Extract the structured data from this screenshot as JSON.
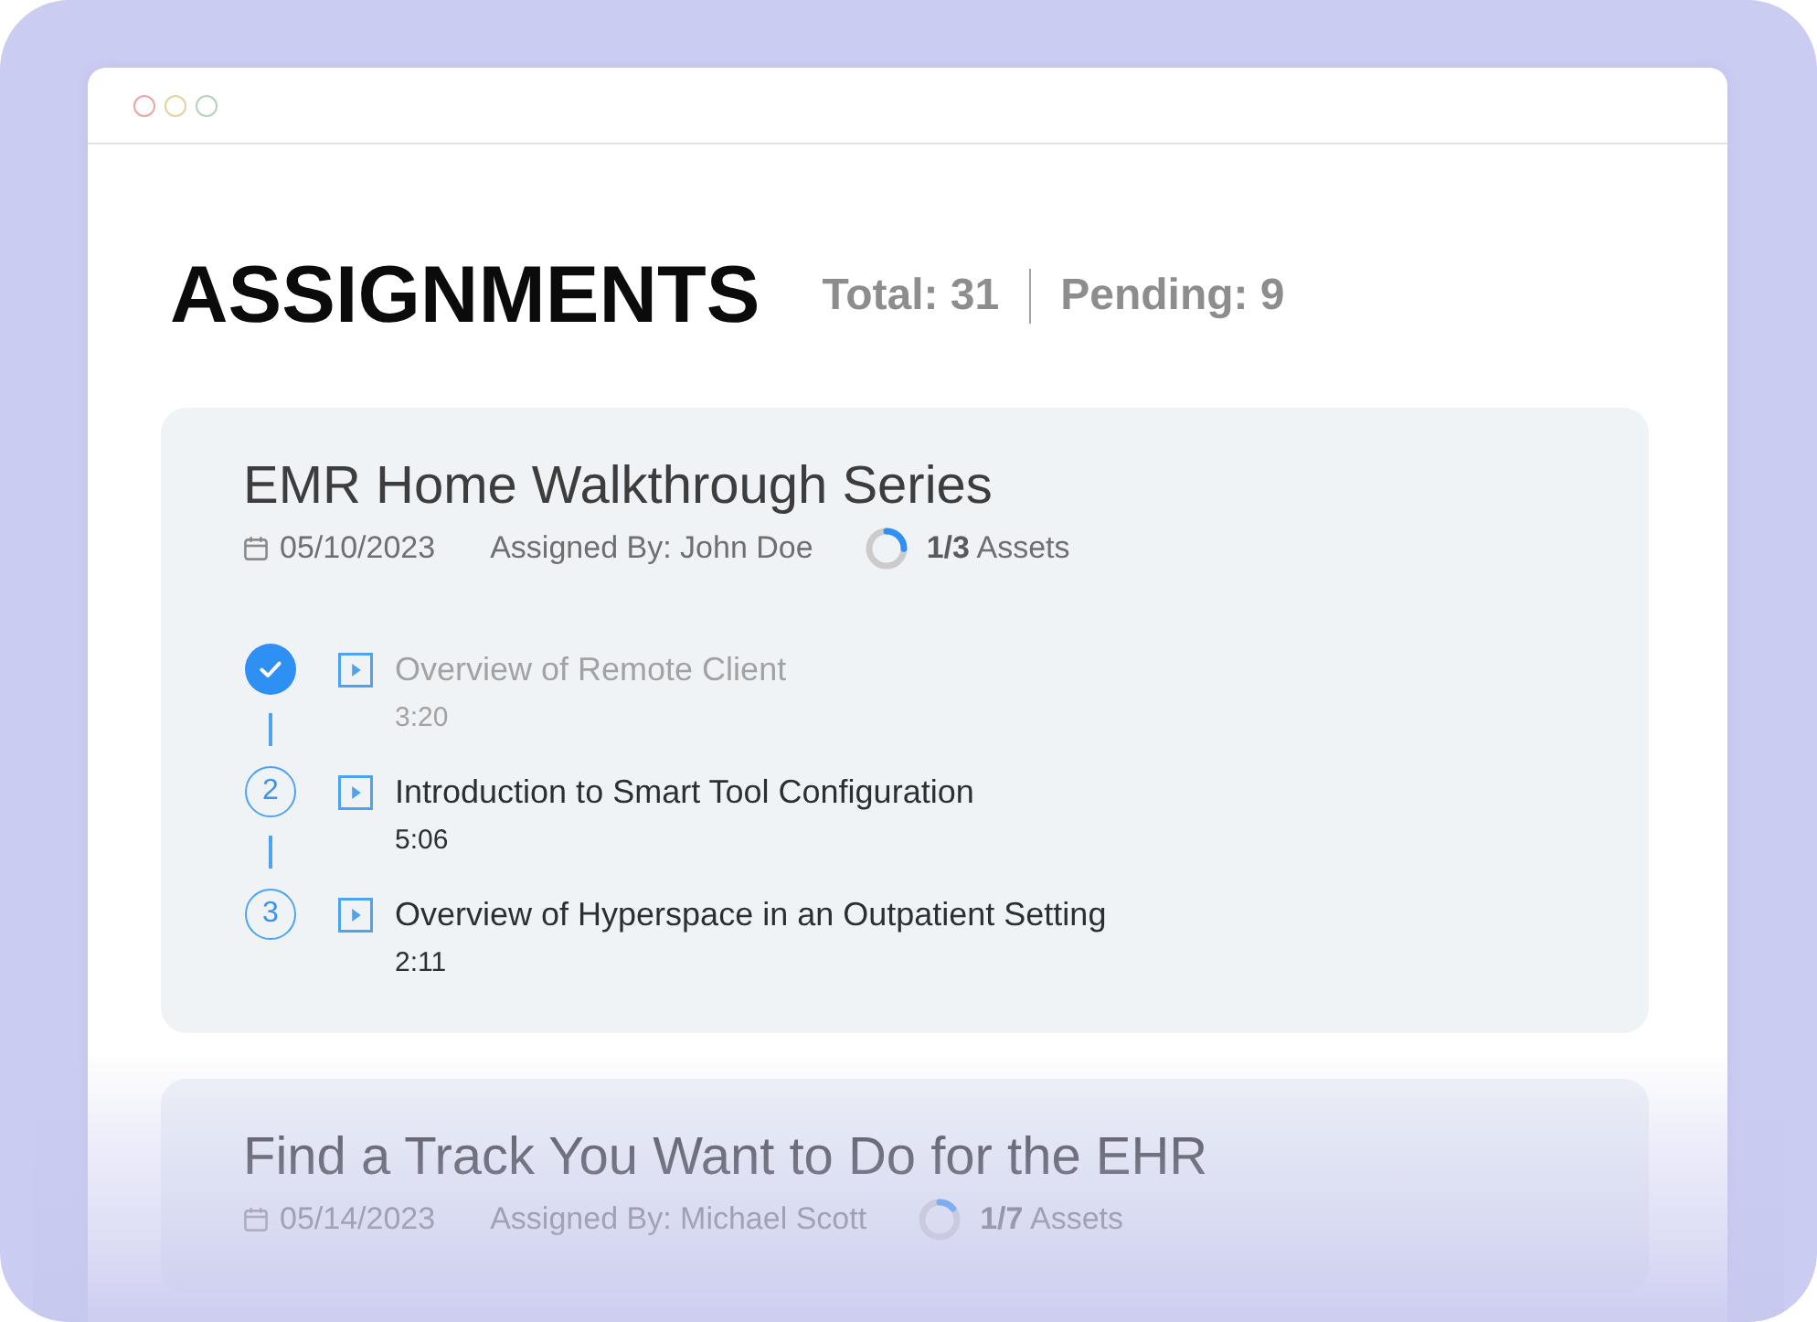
{
  "header": {
    "title": "ASSIGNMENTS",
    "total": "Total: 31",
    "pending": "Pending: 9"
  },
  "assignments": [
    {
      "title": "EMR Home Walkthrough Series",
      "date": "05/10/2023",
      "assigned_by": "Assigned By: John Doe",
      "progress": {
        "level": 0.25,
        "label": "**1/3** Assets"
      },
      "lessons": [
        {
          "completed": true,
          "title": "Overview of Remote Client",
          "duration": "3:20"
        },
        {
          "completed": false,
          "number": "2",
          "title": "Introduction to Smart Tool Configuration",
          "duration": "5:06"
        },
        {
          "completed": false,
          "number": "3",
          "title": "Overview of Hyperspace in an Outpatient Setting",
          "duration": "2:11"
        }
      ]
    },
    {
      "title": "Find a Track You Want to Do for the EHR",
      "date": "05/14/2023",
      "assigned_by": "Assigned By: Michael Scott",
      "progress": {
        "level": 0.14,
        "label": "**1/7** Assets"
      }
    }
  ]
}
